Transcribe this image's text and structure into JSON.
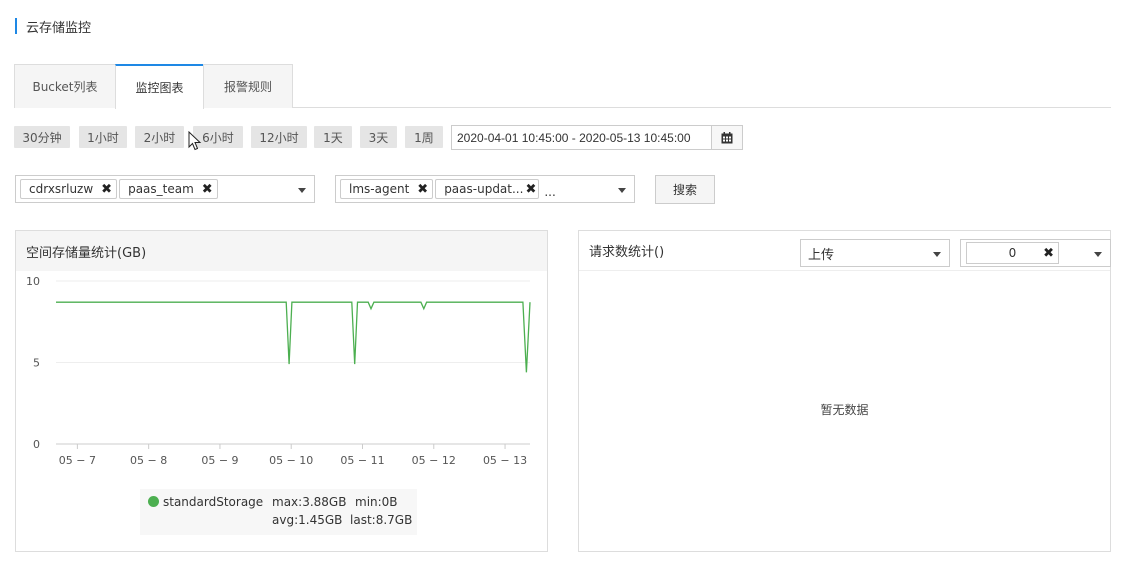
{
  "page": {
    "title": "云存储监控"
  },
  "tabs": [
    {
      "label": "Bucket列表",
      "active": false
    },
    {
      "label": "监控图表",
      "active": true
    },
    {
      "label": "报警规则",
      "active": false
    }
  ],
  "time_range": {
    "quick_buttons": [
      "30分钟",
      "1小时",
      "2小时",
      "6小时",
      "12小时",
      "1天",
      "3天",
      "1周"
    ],
    "date_value": "2020-04-01 10:45:00 - 2020-05-13 10:45:00",
    "calendar_icon": "calendar-icon"
  },
  "filters": {
    "buckets": [
      "cdrxsrluzw",
      "paas_team"
    ],
    "agents": [
      "lms-agent",
      "paas-updat..."
    ],
    "agents_more": "...",
    "search_label": "搜索"
  },
  "storage_panel": {
    "title": "空间存储量统计(GB)",
    "legend": {
      "series_name": "standardStorage",
      "max": "max:3.88GB",
      "min": "min:0B",
      "avg": "avg:1.45GB",
      "last": "last:8.7GB"
    }
  },
  "request_panel": {
    "title": "请求数统计()",
    "type_select": "上传",
    "value_select": "0",
    "empty_text": "暂无数据"
  },
  "colors": {
    "accent": "#1e88e5",
    "series": "#4caf50"
  },
  "chart_data": {
    "type": "line",
    "ylim": [
      0,
      10
    ],
    "yticks": [
      0,
      5,
      10
    ],
    "xticks": [
      "05 − 7",
      "05 − 8",
      "05 − 9",
      "05 − 10",
      "05 − 11",
      "05 − 12",
      "05 − 13"
    ],
    "xtick_days": [
      7,
      8,
      9,
      10,
      11,
      12,
      13
    ],
    "xlim": [
      6.7,
      13.35
    ],
    "series": [
      {
        "name": "standardStorage",
        "x": [
          6.7,
          9.93,
          9.97,
          10.01,
          10.85,
          10.89,
          10.93,
          11.08,
          11.12,
          11.16,
          11.82,
          11.86,
          11.9,
          13.25,
          13.3,
          13.35
        ],
        "values": [
          8.7,
          8.7,
          4.9,
          8.7,
          8.7,
          4.9,
          8.7,
          8.7,
          8.3,
          8.7,
          8.7,
          8.3,
          8.7,
          8.7,
          4.4,
          8.7
        ]
      }
    ]
  }
}
